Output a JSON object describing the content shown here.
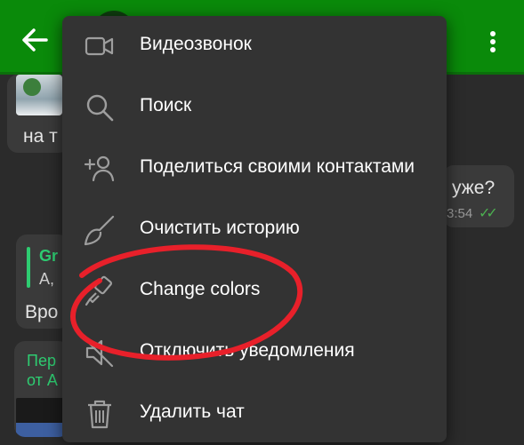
{
  "chat": {
    "bubble1_text": "на т",
    "bubble2_text": "уже?",
    "bubble2_time": "3:54",
    "bubble2_ticks": "✓✓",
    "bubble3_reply_name": "Gr",
    "bubble3_reply_text": "А,",
    "bubble3_text": "Вро",
    "bubble4_forward_line1": "Пер",
    "bubble4_forward_line2": "от А"
  },
  "menu": {
    "items": [
      {
        "label": "Видеозвонок",
        "icon": "video-camera-icon"
      },
      {
        "label": "Поиск",
        "icon": "search-icon"
      },
      {
        "label": "Поделиться своими контактами",
        "icon": "add-person-icon"
      },
      {
        "label": "Очистить историю",
        "icon": "broom-icon"
      },
      {
        "label": "Change colors",
        "icon": "paintbrush-icon"
      },
      {
        "label": "Отключить уведомления",
        "icon": "mute-icon"
      },
      {
        "label": "Удалить чат",
        "icon": "trash-icon"
      }
    ]
  },
  "colors": {
    "topbar": "#0a8a0a",
    "menu_background": "#333333",
    "annotation": "#e8202a",
    "accent_green": "#2ecc71"
  }
}
